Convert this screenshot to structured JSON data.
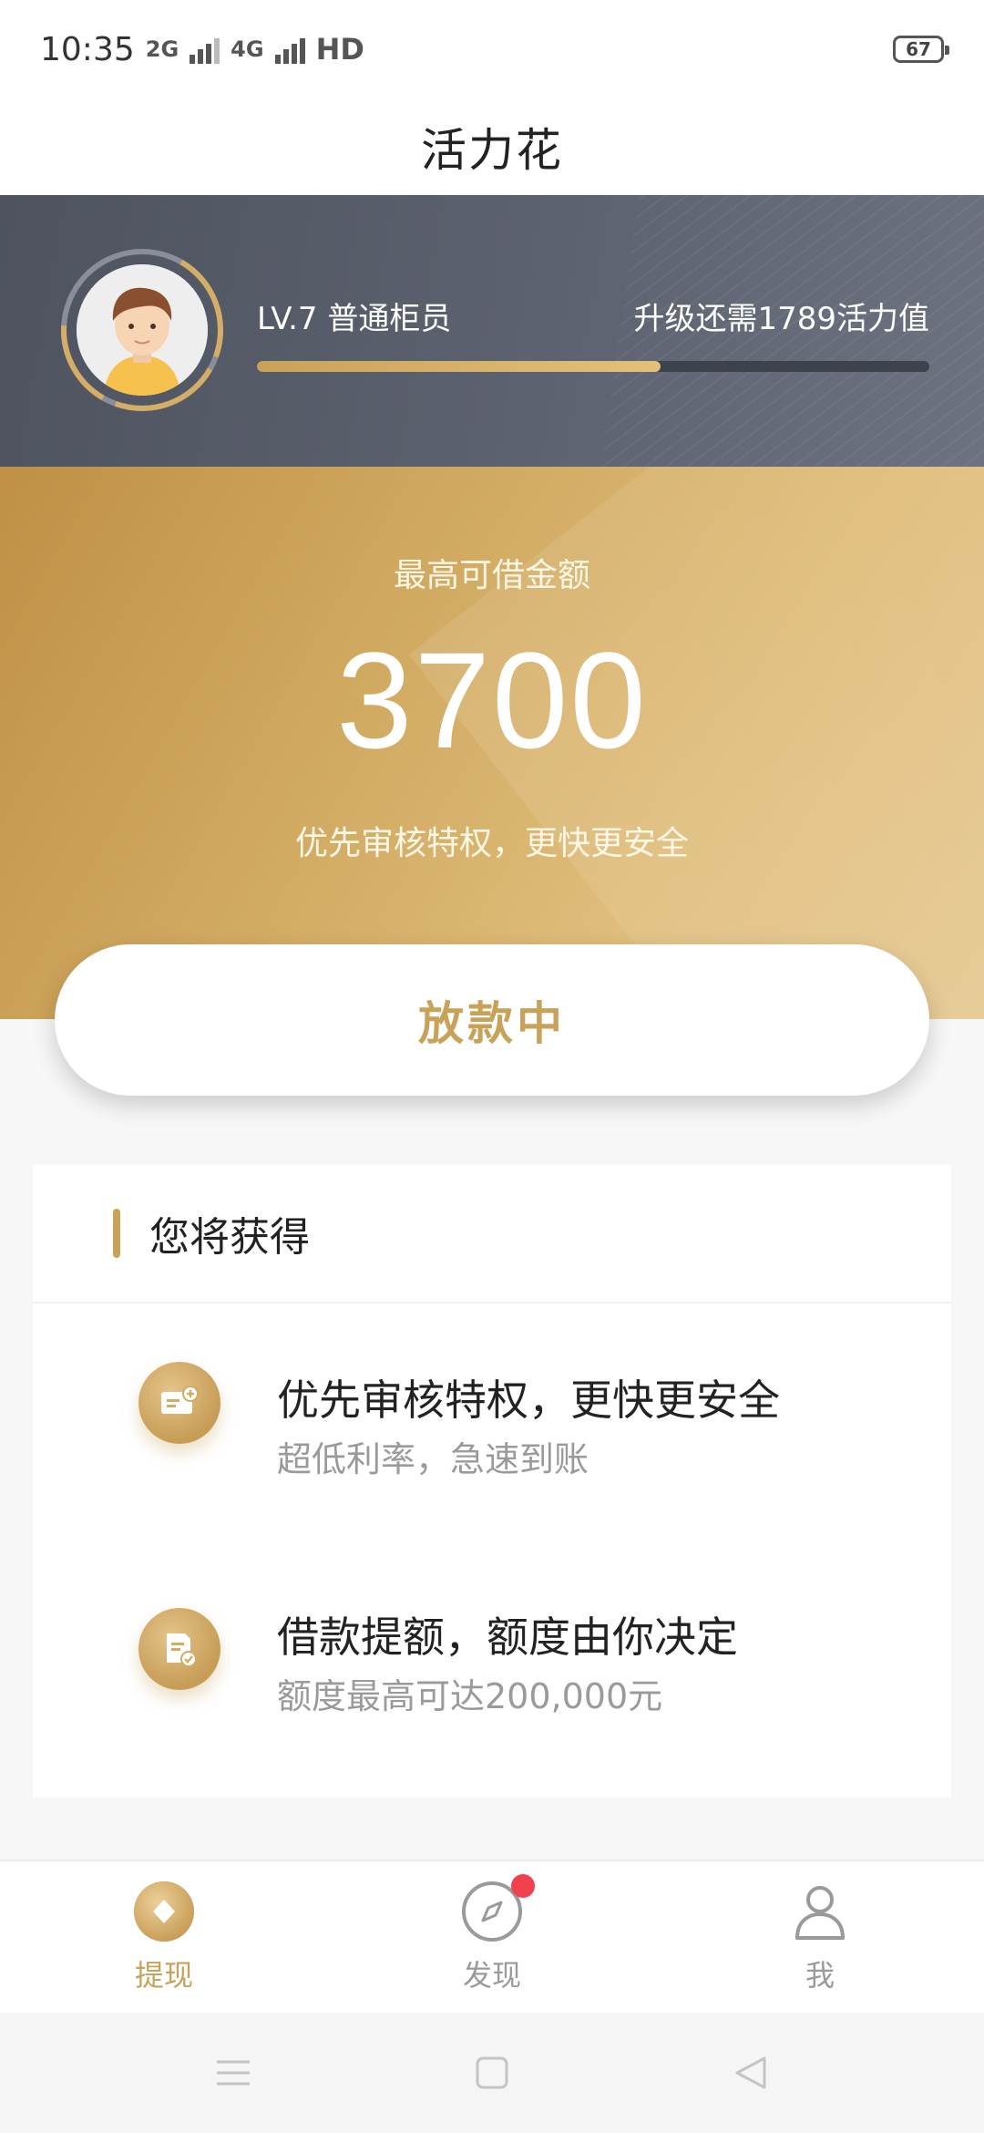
{
  "status_bar": {
    "time": "10:35",
    "network_1": "2G",
    "network_2": "4G",
    "hd_label": "HD",
    "battery": "67"
  },
  "header": {
    "title": "活力花"
  },
  "level": {
    "label": "LV.7 普通柜员",
    "upgrade_text": "升级还需1789活力值",
    "progress_fraction": 0.6
  },
  "hero": {
    "label": "最高可借金额",
    "amount": "3700",
    "subtitle": "优先审核特权，更快更安全"
  },
  "action": {
    "label": "放款中"
  },
  "benefits": {
    "title": "您将获得",
    "items": [
      {
        "title": "优先审核特权，更快更安全",
        "desc": "超低利率，急速到账",
        "icon": "card-plus-icon"
      },
      {
        "title": "借款提额，额度由你决定",
        "desc": "额度最高可达200,000元",
        "icon": "document-check-icon"
      }
    ]
  },
  "bottom_nav": {
    "items": [
      {
        "label": "提现",
        "icon": "diamond-coin-icon",
        "active": true
      },
      {
        "label": "发现",
        "icon": "compass-icon",
        "badge": true
      },
      {
        "label": "我",
        "icon": "user-icon"
      }
    ]
  },
  "colors": {
    "gold": "#c9a25a",
    "dark_banner": "#555a66",
    "badge_red": "#f1414e"
  }
}
